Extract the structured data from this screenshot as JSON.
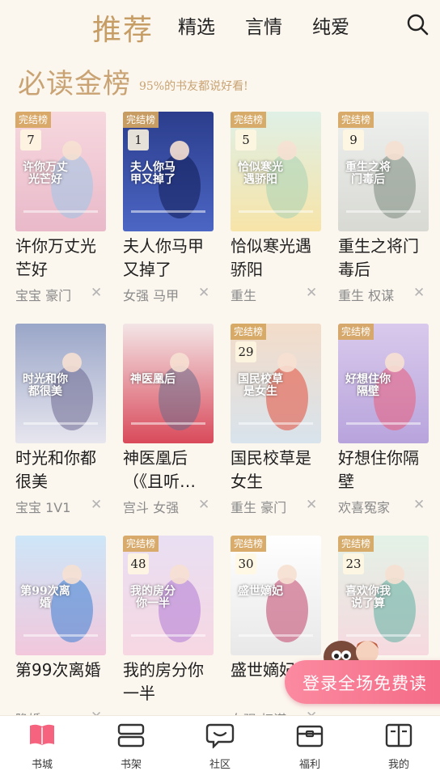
{
  "tabs": [
    {
      "label": "推荐",
      "active": true
    },
    {
      "label": "精选",
      "active": false
    },
    {
      "label": "言情",
      "active": false
    },
    {
      "label": "纯爱",
      "active": false
    }
  ],
  "section": {
    "title": "必读金榜",
    "subtitle": "95%的书友都说好看!"
  },
  "books": [
    {
      "title": "许你万丈光芒好",
      "tags": "宝宝 豪门",
      "badge": "完结榜",
      "rank": "7",
      "cover_text": "许你万丈光芒好",
      "palette": [
        "#f7d8df",
        "#e9b9c9",
        "#9cc6e8"
      ]
    },
    {
      "title": "夫人你马甲又掉了",
      "tags": "女强 马甲",
      "badge": "完结榜",
      "rank": "1",
      "cover_text": "夫人你马甲又掉了",
      "palette": [
        "#2b3d8c",
        "#4c66c4",
        "#101c55"
      ]
    },
    {
      "title": "恰似寒光遇骄阳",
      "tags": "重生",
      "badge": "完结榜",
      "rank": "5",
      "cover_text": "恰似寒光遇骄阳",
      "palette": [
        "#dff0e6",
        "#f7e4a8",
        "#a7d1b4"
      ]
    },
    {
      "title": "重生之将门毒后",
      "tags": "重生 权谋",
      "badge": "完结榜",
      "rank": "9",
      "cover_text": "重生之将门毒后",
      "palette": [
        "#eef0ee",
        "#d8d9d3",
        "#7c8a7e"
      ]
    },
    {
      "title": "时光和你都很美",
      "tags": "宝宝 1V1",
      "badge": "",
      "rank": "",
      "cover_text": "时光和你都很美",
      "palette": [
        "#9aa6c8",
        "#e7e6ef",
        "#6e6a92"
      ]
    },
    {
      "title": "神医凰后（《且听…",
      "tags": "宫斗 女强",
      "badge": "",
      "rank": "",
      "cover_text": "神医凰后",
      "palette": [
        "#f3e5e6",
        "#d94a5b",
        "#6b6b8a"
      ]
    },
    {
      "title": "国民校草是女生",
      "tags": "重生 豪门",
      "badge": "完结榜",
      "rank": "29",
      "cover_text": "国民校草是女生",
      "palette": [
        "#f3dcc9",
        "#d8e3ec",
        "#e44c3a"
      ]
    },
    {
      "title": "好想住你隔壁",
      "tags": "欢喜冤家",
      "badge": "完结榜",
      "rank": "",
      "cover_text": "好想住你隔壁",
      "palette": [
        "#d9c9ec",
        "#b8a4dc",
        "#e95c7a"
      ]
    },
    {
      "title": "第99次离婚",
      "tags": "隐婚",
      "badge": "",
      "rank": "",
      "cover_text": "第99次离婚",
      "palette": [
        "#cde6f8",
        "#f2c7dc",
        "#3a7fd4"
      ]
    },
    {
      "title": "我的房分你一半",
      "tags": "",
      "badge": "完结榜",
      "rank": "48",
      "cover_text": "我的房分你一半",
      "palette": [
        "#e9dff3",
        "#f6d7e2",
        "#b07ad6"
      ]
    },
    {
      "title": "盛世嫡妃",
      "tags": "女强 权谋",
      "badge": "完结榜",
      "rank": "30",
      "cover_text": "盛世嫡妃",
      "palette": [
        "#ffffff",
        "#e8e8e8",
        "#c1446b"
      ]
    },
    {
      "title": "喜欢你我说了算",
      "tags": "",
      "badge": "完结榜",
      "rank": "23",
      "cover_text": "喜欢你我说了算",
      "palette": [
        "#e3f2e6",
        "#f6d9df",
        "#5db0a2"
      ]
    }
  ],
  "promo": {
    "label": "登录全场免费读"
  },
  "bottom_nav": [
    {
      "label": "书城",
      "icon": "book-open-icon",
      "active": true
    },
    {
      "label": "书架",
      "icon": "bookshelf-icon",
      "active": false
    },
    {
      "label": "社区",
      "icon": "chat-bubble-icon",
      "active": false
    },
    {
      "label": "福利",
      "icon": "gift-box-icon",
      "active": false
    },
    {
      "label": "我的",
      "icon": "profile-book-icon",
      "active": false
    }
  ],
  "colors": {
    "accent": "#c9a373",
    "nav_active": "#f6637f",
    "badge": "#d6a55f",
    "background": "#fbf6ee"
  }
}
